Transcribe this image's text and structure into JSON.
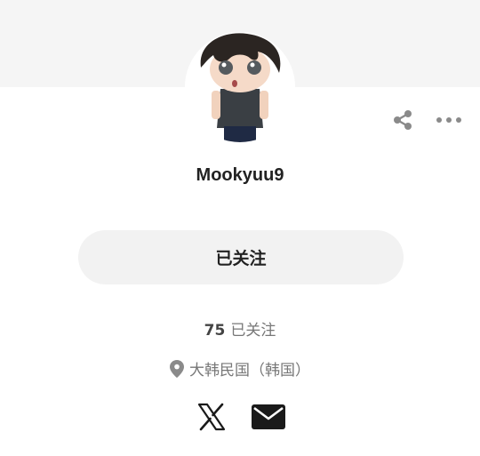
{
  "profile": {
    "username": "Mookyuu9",
    "follow_button_label": "已关注",
    "following_count": "75",
    "following_label": "已关注",
    "location": "大韩民国（韩国）"
  },
  "icons": {
    "share": "share-icon",
    "more": "more-horizontal-icon",
    "location": "location-pin-icon",
    "x": "x-logo-icon",
    "email": "mail-icon"
  },
  "colors": {
    "cover": "#f5f5f5",
    "button_bg": "#f2f2f2",
    "text_primary": "#222222",
    "text_secondary": "#777777",
    "icon_gray": "#8a8a8a"
  }
}
